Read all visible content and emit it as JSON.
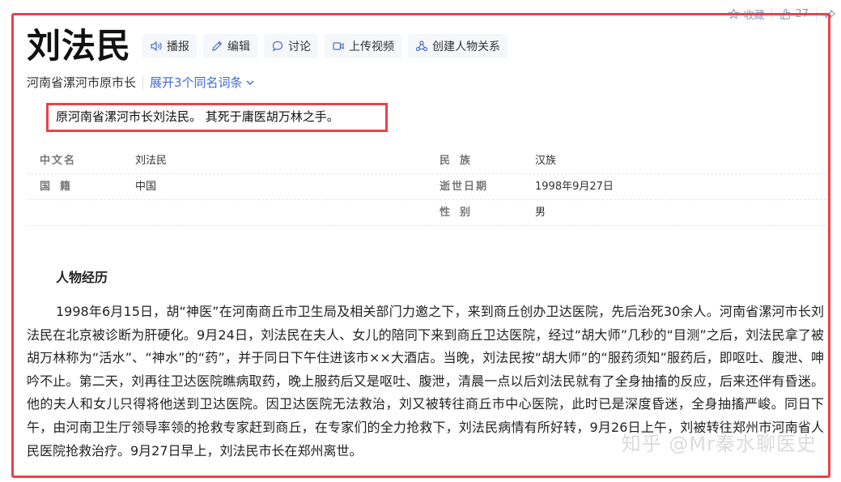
{
  "top_actions": {
    "favorite_label": "收藏",
    "like_count": "27"
  },
  "header": {
    "title": "刘法民",
    "tools": {
      "read": "播报",
      "edit": "编辑",
      "discuss": "讨论",
      "upload_video": "上传视频",
      "relation": "创建人物关系"
    }
  },
  "subtitle": {
    "text": "河南省漯河市原市长",
    "expand": "展开3个同名词条"
  },
  "summary": "原河南省漯河市长刘法民。 其死于庸医胡万林之手。",
  "infobox": {
    "rows": [
      {
        "left_label": "中文名",
        "left_value": "刘法民",
        "right_label": "民族",
        "right_value": "汉族"
      },
      {
        "left_label": "国籍",
        "left_value": "中国",
        "right_label": "逝世日期",
        "right_value": "1998年9月27日"
      },
      {
        "right_label": "性别",
        "right_value": "男"
      }
    ]
  },
  "section_title": "人物经历",
  "body": "1998年6月15日，胡“神医”在河南商丘市卫生局及相关部门力邀之下，来到商丘创办卫达医院，先后治死30余人。河南省漯河市长刘法民在北京被诊断为肝硬化。9月24日，刘法民在夫人、女儿的陪同下来到商丘卫达医院，经过“胡大师”几秒的“目测”之后，刘法民拿了被胡万林称为“活水”、“神水”的“药”，并于同日下午住进该市××大酒店。当晚，刘法民按“胡大师”的“服药须知”服药后，即呕吐、腹泄、呻吟不止。第二天，刘再往卫达医院瞧病取药，晚上服药后又是呕吐、腹泄，清晨一点以后刘法民就有了全身抽搐的反应，后来还伴有昏迷。他的夫人和女儿只得将他送到卫达医院。因卫达医院无法救治，刘又被转往商丘市中心医院，此时已是深度昏迷，全身抽搐严峻。同日下午，由河南卫生厅领导率领的抢救专家赶到商丘，在专家们的全力抢救下，刘法民病情有所好转，9月26日上午，刘被转往郑州市河南省人民医院抢救治疗。9月27日早上，刘法民市长在郑州离世。",
  "watermark": "知乎 @Mr秦水聊医史",
  "colors": {
    "highlight_border": "#e8434a",
    "link": "#3f6bd4",
    "tool_bg": "#f5f7fa"
  }
}
